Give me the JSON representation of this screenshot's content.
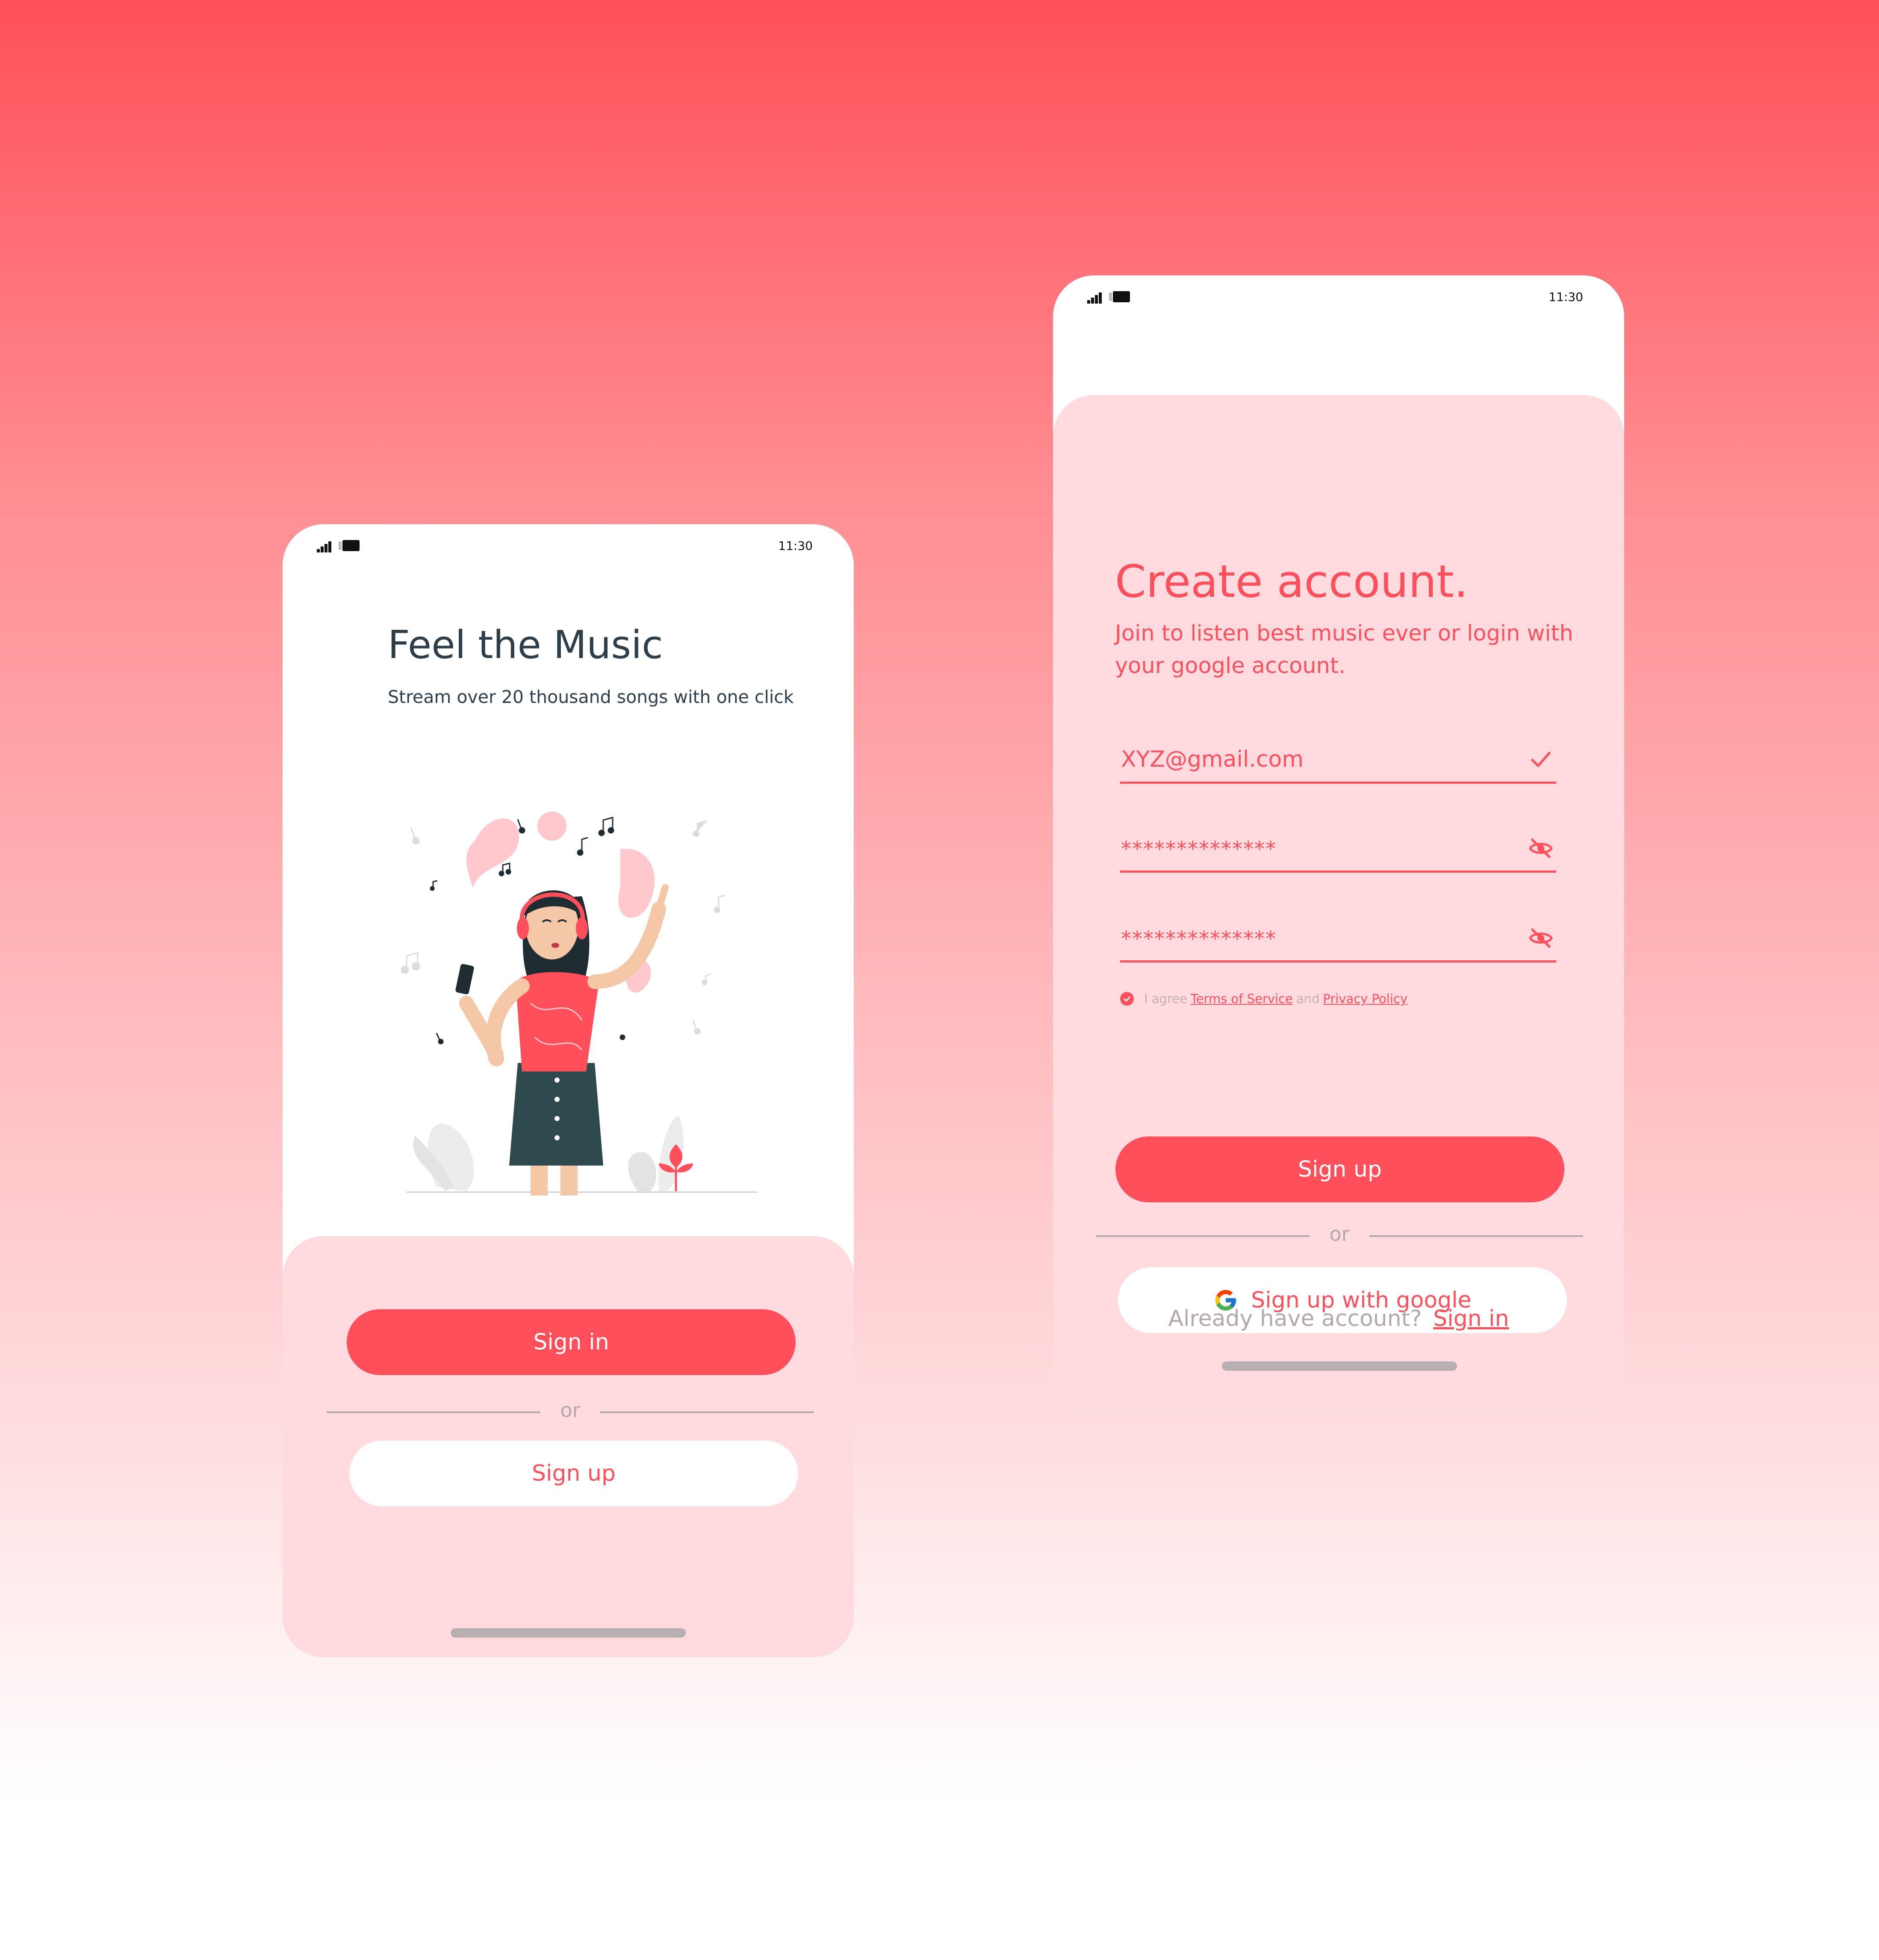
{
  "status_bar": {
    "time": "11:30"
  },
  "welcome": {
    "title": "Feel the Music",
    "subtitle": "Stream over 20 thousand songs with one click",
    "sign_in_label": "Sign in",
    "or_label": "or",
    "sign_up_label": "Sign up"
  },
  "register": {
    "title": "Create account.",
    "subtitle": "Join to listen best music ever or login with your google account.",
    "email_value": "XYZ@gmail.com",
    "password_value": "**************",
    "confirm_password_value": "**************",
    "agree_prefix": "I agree",
    "terms_label": "Terms of Service",
    "and_label": "and",
    "privacy_label": "Privacy Policy",
    "sign_up_label": "Sign up",
    "or_label": "or",
    "google_label": "Sign up with google",
    "already_label": "Already have account?",
    "sign_in_link": "Sign in"
  },
  "colors": {
    "accent": "#ff4f5a",
    "sheet": "#ffdbdf",
    "title_dark": "#2d3e48",
    "muted": "#b3a9ab"
  },
  "icons": [
    "signal-icon",
    "battery-icon",
    "check-icon",
    "eye-off-icon",
    "google-icon",
    "checkbox-checked-icon"
  ]
}
